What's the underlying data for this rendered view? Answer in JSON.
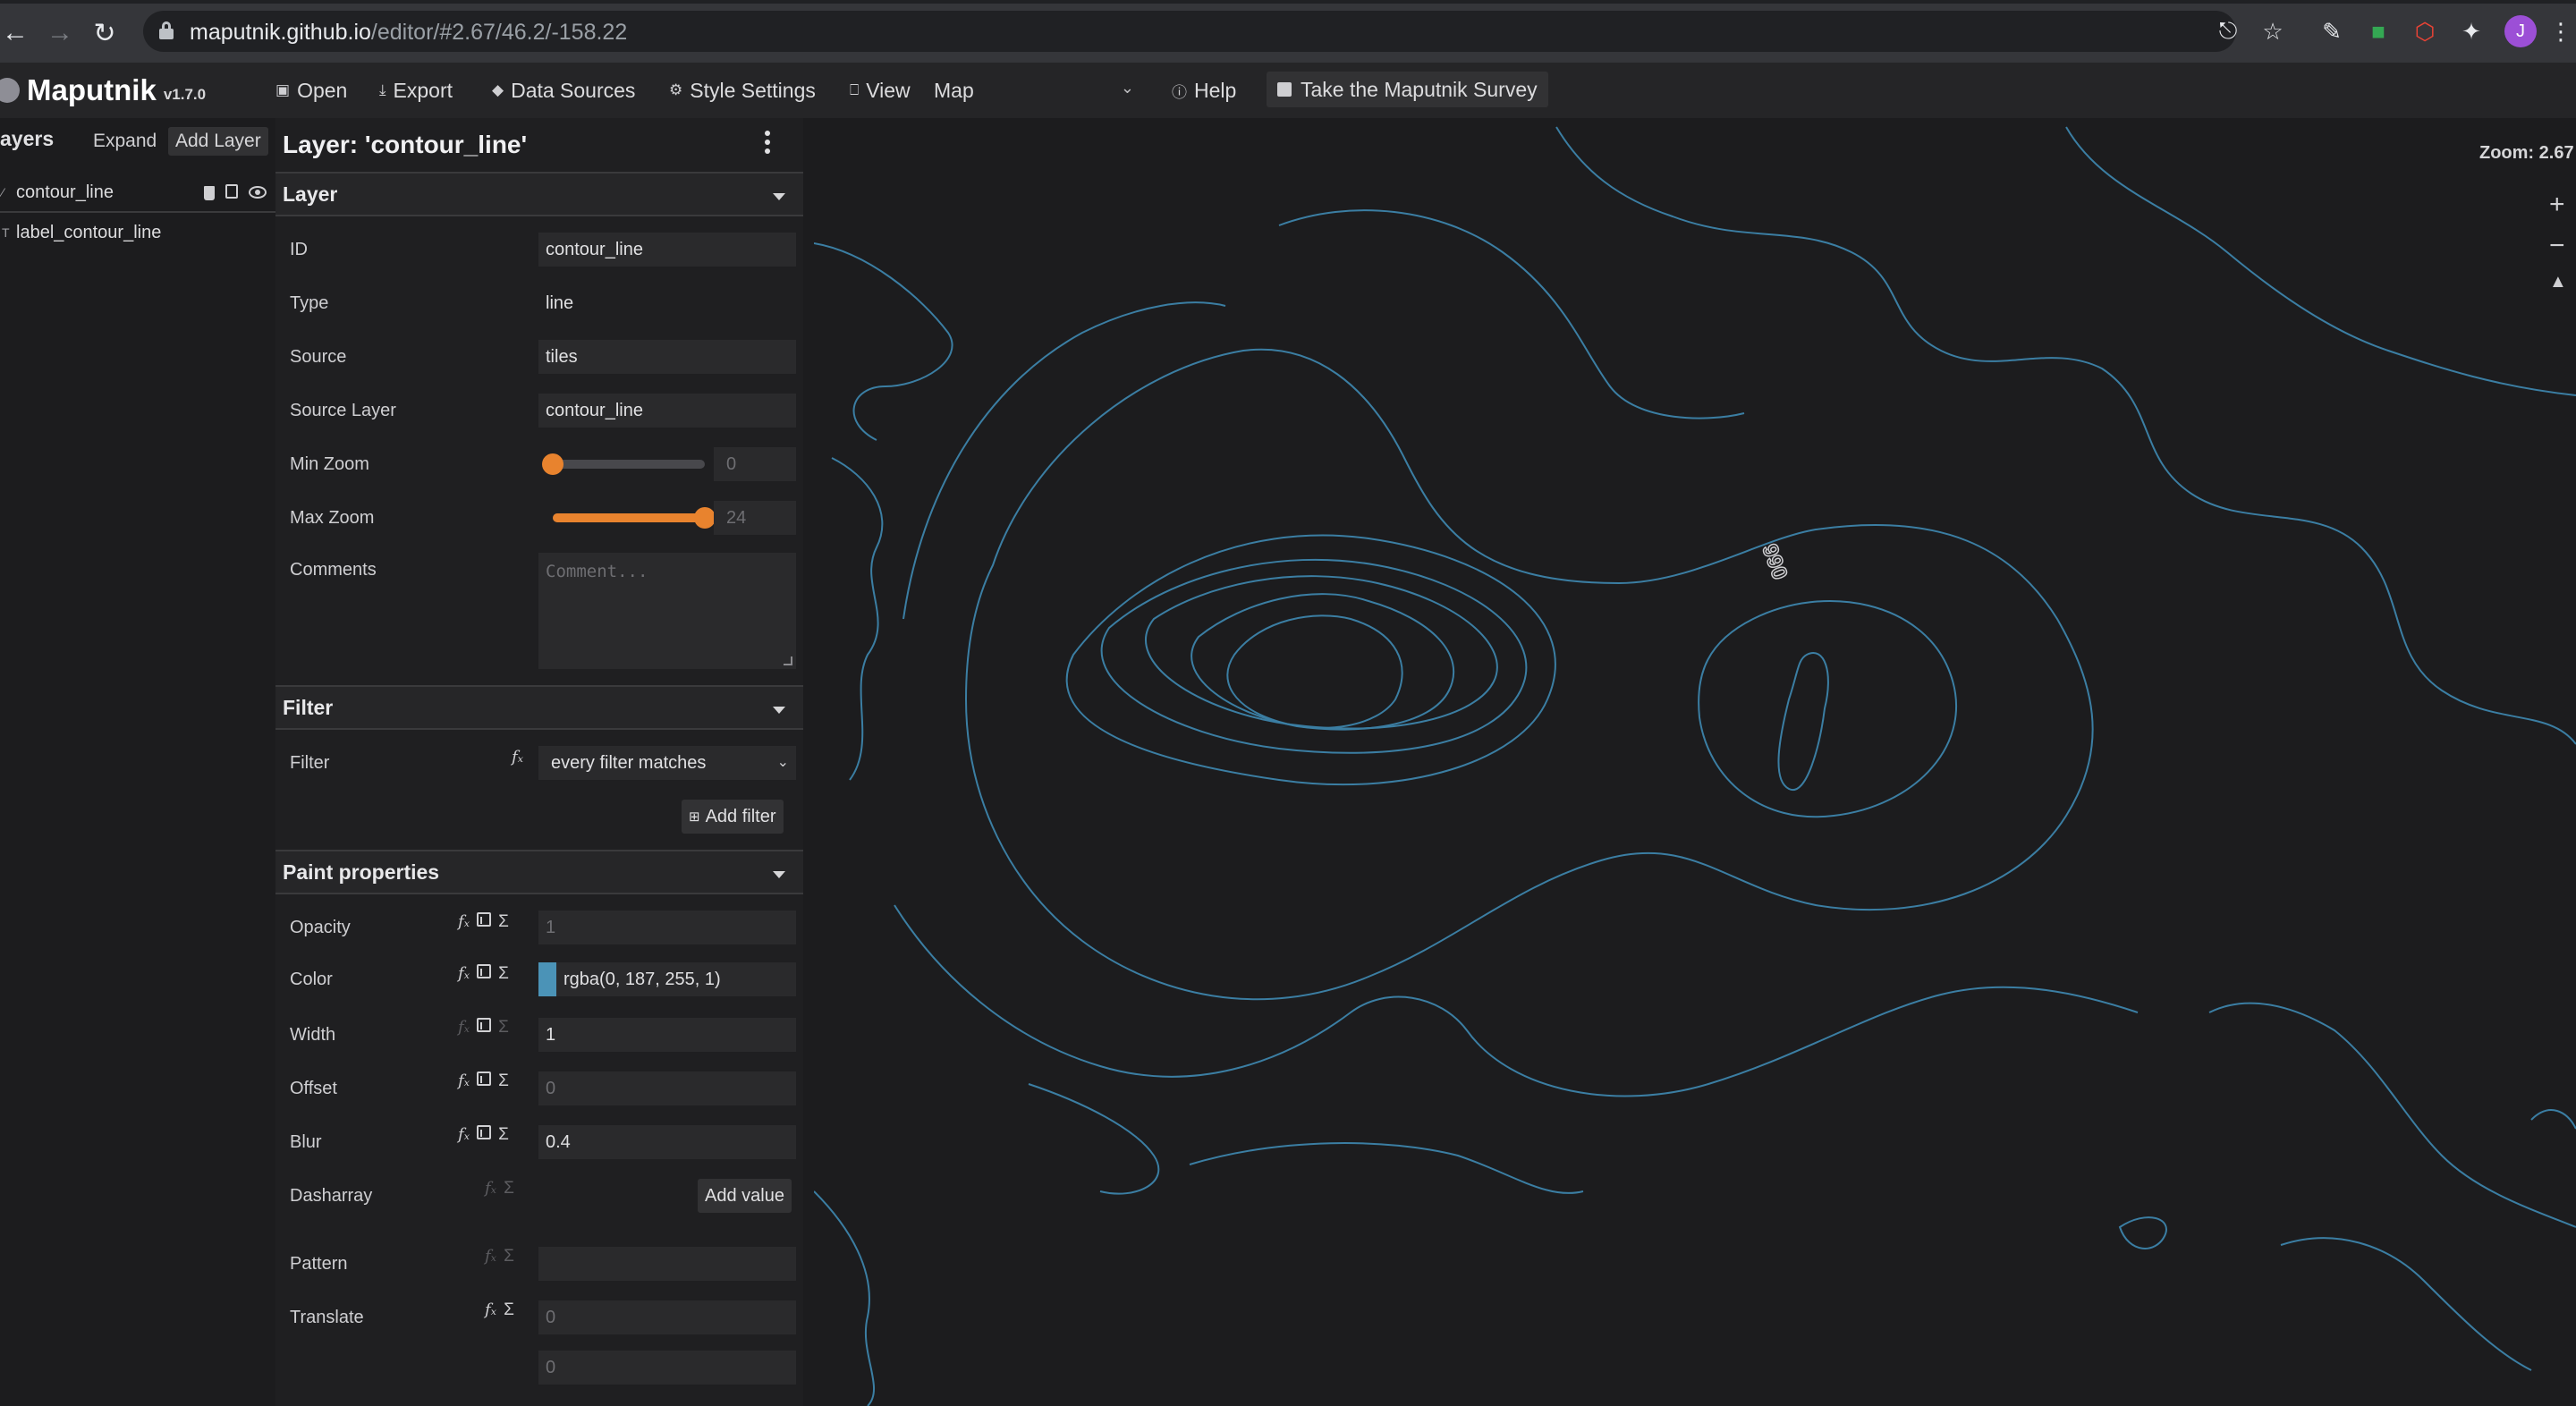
{
  "browser": {
    "url_host": "maputnik.github.io",
    "url_path": "/editor/#2.67/46.2/-158.22",
    "avatar_initial": "J"
  },
  "app": {
    "name": "Maputnik",
    "version": "v1.7.0",
    "toolbar": {
      "open": "Open",
      "export": "Export",
      "data_sources": "Data Sources",
      "style_settings": "Style Settings",
      "view": "View",
      "view_value": "Map",
      "help": "Help",
      "survey": "Take the Maputnik Survey"
    }
  },
  "layer_list": {
    "title": "ayers",
    "expand": "Expand",
    "add_layer": "Add Layer",
    "items": [
      {
        "type_tag": "⁄",
        "name": "contour_line"
      },
      {
        "type_tag": "T",
        "name": "label_contour_line"
      }
    ]
  },
  "editor": {
    "title": "Layer: 'contour_line'",
    "layer_section": {
      "label": "Layer",
      "id_label": "ID",
      "id_value": "contour_line",
      "type_label": "Type",
      "type_value": "line",
      "source_label": "Source",
      "source_value": "tiles",
      "source_layer_label": "Source Layer",
      "source_layer_value": "contour_line",
      "min_zoom_label": "Min Zoom",
      "min_zoom_value": "0",
      "min_zoom_fraction": 0,
      "max_zoom_label": "Max Zoom",
      "max_zoom_value": "24",
      "max_zoom_fraction": 1,
      "comments_label": "Comments",
      "comments_placeholder": "Comment..."
    },
    "filter_section": {
      "label": "Filter",
      "filter_label": "Filter",
      "filter_value": "every filter matches",
      "add_filter": "Add filter"
    },
    "paint_section": {
      "label": "Paint properties",
      "opacity_label": "Opacity",
      "opacity_value": "1",
      "color_label": "Color",
      "color_value": "rgba(0, 187, 255, 1)",
      "width_label": "Width",
      "width_value": "1",
      "offset_label": "Offset",
      "offset_value": "0",
      "blur_label": "Blur",
      "blur_value": "0.4",
      "dasharray_label": "Dasharray",
      "dasharray_button": "Add value",
      "pattern_label": "Pattern",
      "translate_label": "Translate",
      "translate_x": "0",
      "translate_y": "0"
    }
  },
  "map": {
    "zoom_text": "Zoom: 2.67",
    "contour_label": "990",
    "line_color": "#3b7ea3"
  }
}
